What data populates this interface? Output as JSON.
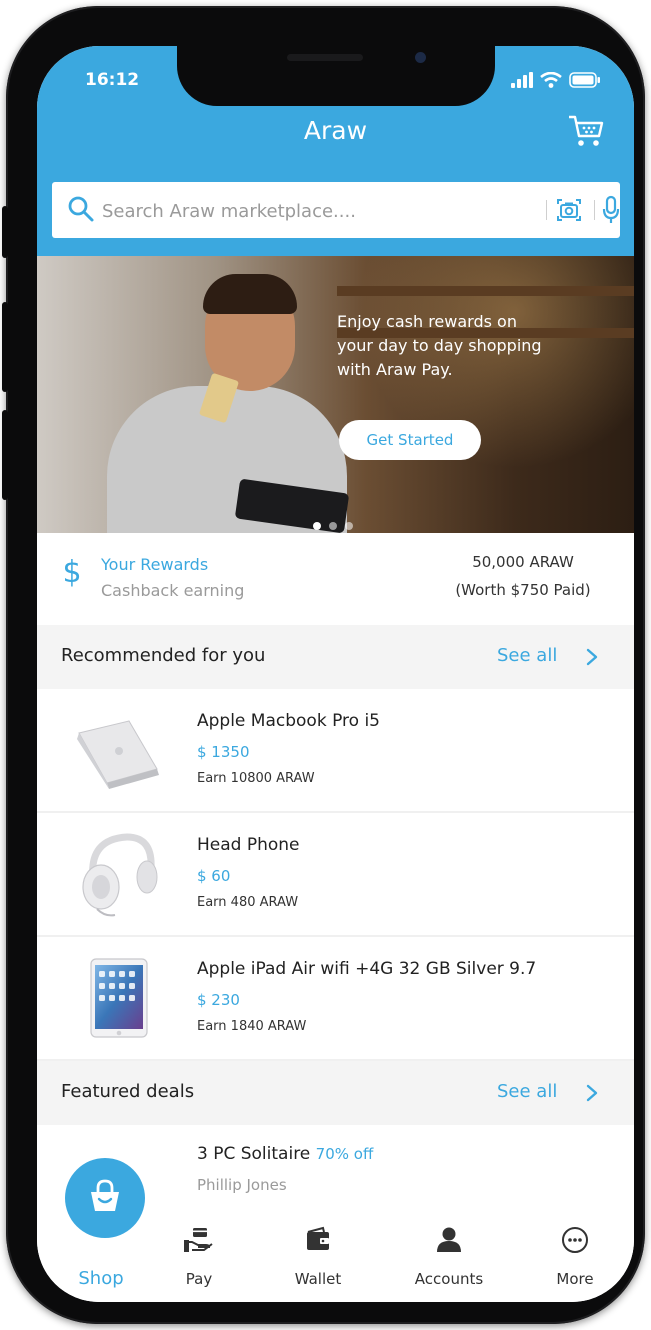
{
  "status": {
    "time": "16:12"
  },
  "header": {
    "title": "Araw"
  },
  "search": {
    "placeholder": "Search Araw marketplace...."
  },
  "banner": {
    "line1": "Enjoy cash rewards on",
    "line2": "your day to day shopping",
    "line3": "with Araw Pay.",
    "button_label": "Get Started"
  },
  "rewards": {
    "icon_symbol": "$",
    "title": "Your Rewards",
    "subtitle": "Cashback earning",
    "amount": "50,000 ARAW",
    "worth": "(Worth $750 Paid)"
  },
  "recommended": {
    "title": "Recommended for you",
    "see_all": "See all",
    "items": [
      {
        "name": "Apple Macbook Pro i5",
        "price": "$ 1350",
        "earn": "Earn 10800 ARAW",
        "icon": "laptop-icon"
      },
      {
        "name": "Head Phone",
        "price": "$ 60",
        "earn": "Earn 480 ARAW",
        "icon": "headphones-icon"
      },
      {
        "name": "Apple iPad Air wifi +4G 32 GB Silver 9.7",
        "price": "$ 230",
        "earn": "Earn 1840 ARAW",
        "icon": "tablet-icon"
      }
    ]
  },
  "featured": {
    "title": "Featured deals",
    "see_all": "See all",
    "items": [
      {
        "name": "3 PC Solitaire",
        "discount": "70% off",
        "seller": "Phillip Jones"
      }
    ]
  },
  "tabs": [
    {
      "label": "Shop",
      "icon": "shopping-bag-icon",
      "active": true
    },
    {
      "label": "Pay",
      "icon": "pay-icon"
    },
    {
      "label": "Wallet",
      "icon": "wallet-icon"
    },
    {
      "label": "Accounts",
      "icon": "person-icon"
    },
    {
      "label": "More",
      "icon": "more-icon"
    }
  ],
  "colors": {
    "accent": "#3ba8df",
    "text": "#222222",
    "muted": "#9a9a9a",
    "section_bg": "#f4f4f4"
  }
}
